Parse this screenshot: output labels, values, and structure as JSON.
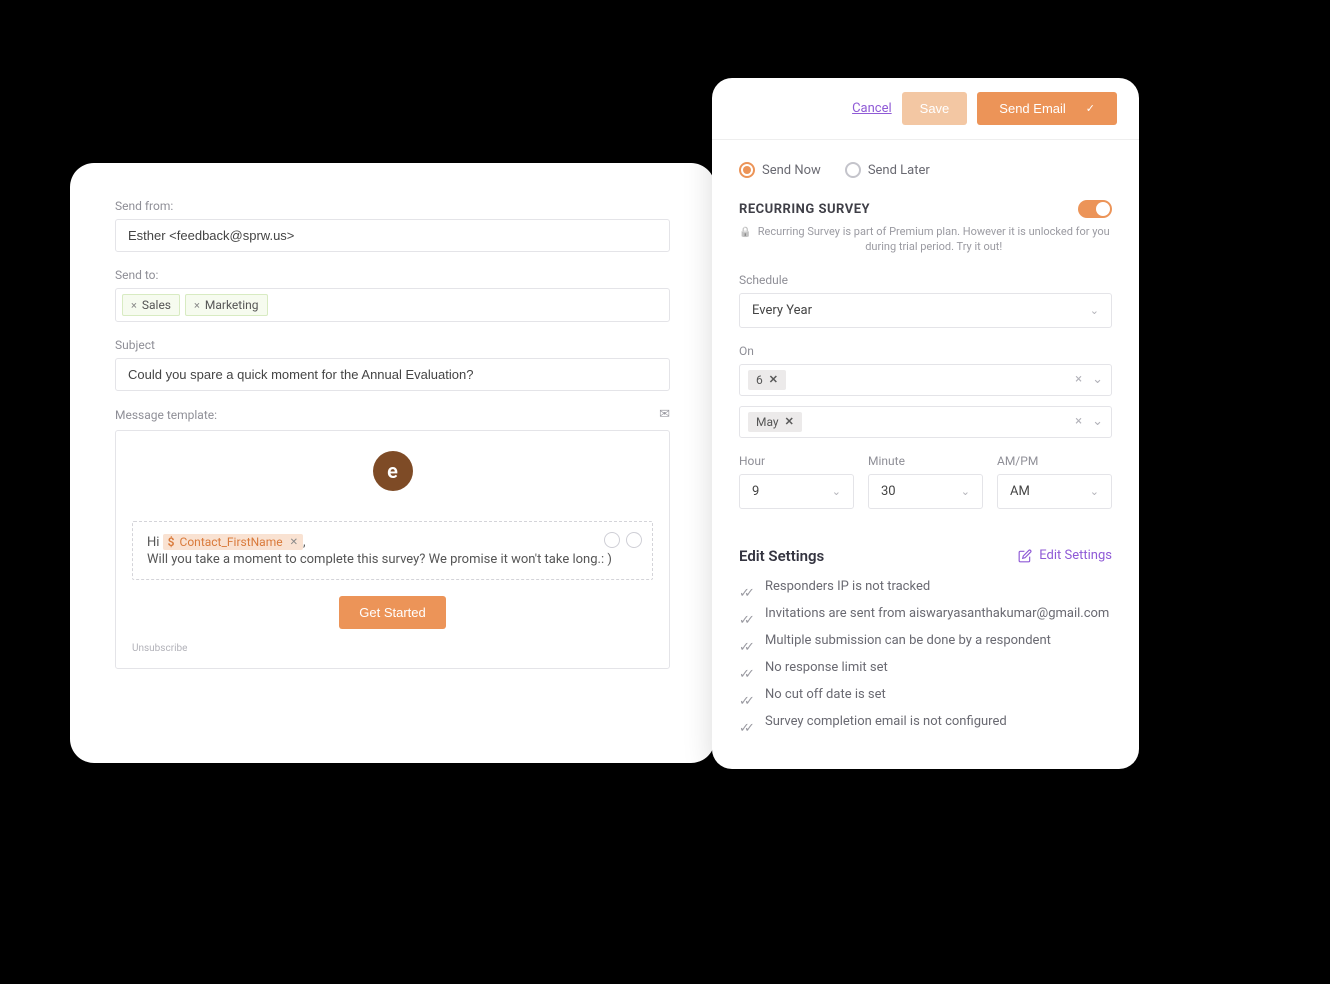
{
  "compose": {
    "send_from_label": "Send from:",
    "send_from_value": "Esther <feedback@sprw.us>",
    "send_to_label": "Send to:",
    "recipients": [
      "Sales",
      "Marketing"
    ],
    "subject_label": "Subject",
    "subject_value": "Could you spare a quick moment for the Annual Evaluation?",
    "message_template_label": "Message template:",
    "logo_letter": "e",
    "greeting_prefix": "Hi ",
    "variable_token": "Contact_FirstName",
    "greeting_suffix": ",",
    "body_line2": "Will you take a moment to complete this survey? We promise it won't take long.: )",
    "cta_label": "Get Started",
    "unsubscribe_label": "Unsubscribe"
  },
  "schedule_panel": {
    "cancel": "Cancel",
    "save": "Save",
    "send_email": "Send Email",
    "radio_send_now": "Send Now",
    "radio_send_later": "Send Later",
    "recurring_title": "RECURRING SURVEY",
    "premium_note": "Recurring Survey is part of Premium plan. However it is unlocked for you during trial period. Try it out!",
    "schedule_label": "Schedule",
    "schedule_value": "Every Year",
    "on_label": "On",
    "on_day_value": "6",
    "on_month_value": "May",
    "hour_label": "Hour",
    "hour_value": "9",
    "minute_label": "Minute",
    "minute_value": "30",
    "ampm_label": "AM/PM",
    "ampm_value": "AM",
    "edit_settings_title": "Edit Settings",
    "edit_settings_link": "Edit Settings",
    "settings": [
      "Responders IP is not tracked",
      "Invitations are sent from aiswaryasanthakumar@gmail.com",
      "Multiple submission can be done by a respondent",
      "No response limit set",
      "No cut off date is set",
      "Survey completion email is not configured"
    ]
  }
}
